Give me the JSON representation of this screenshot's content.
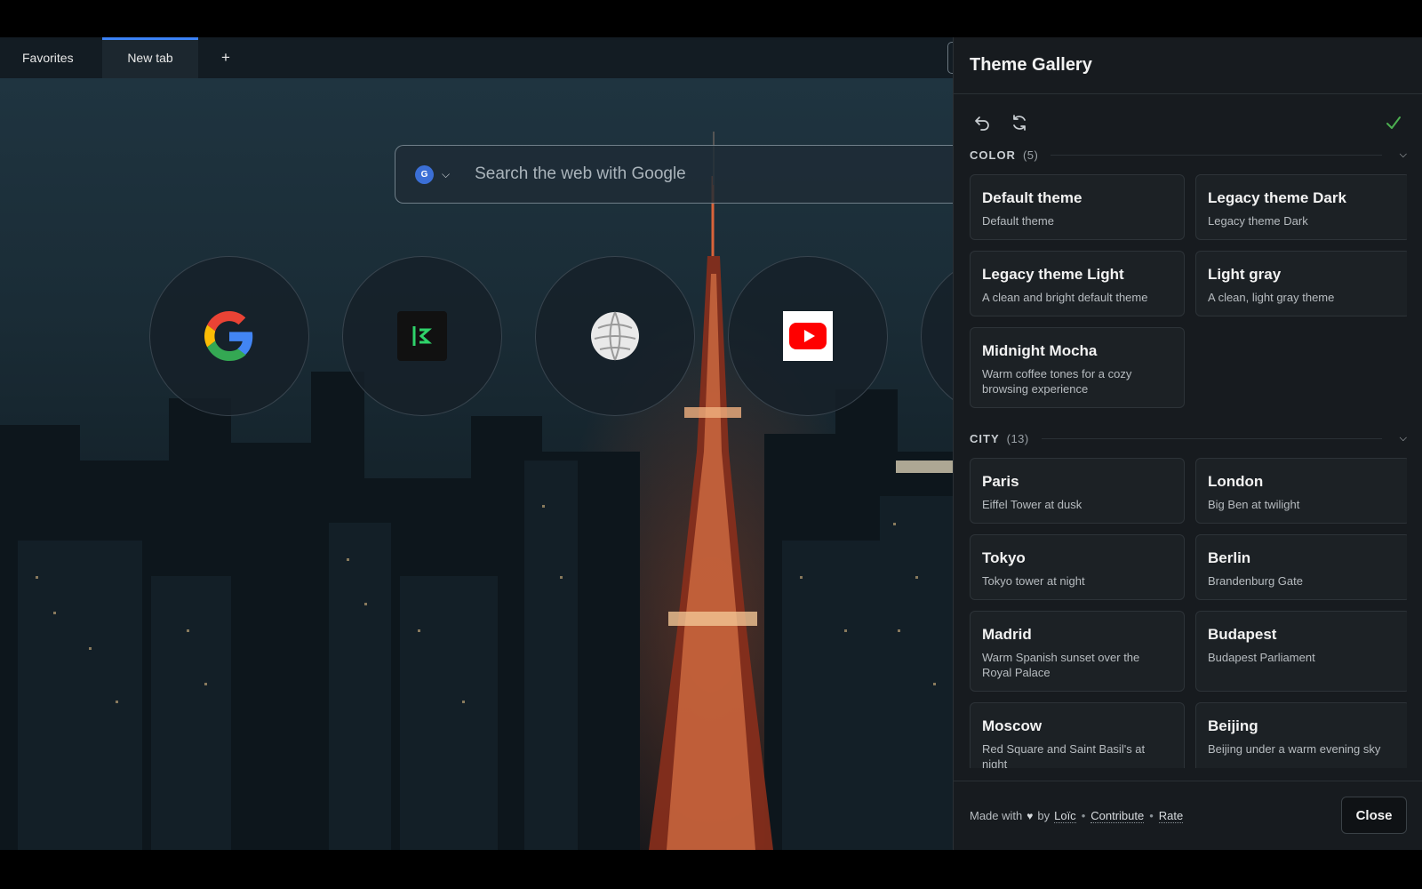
{
  "tabs": [
    {
      "label": "Favorites",
      "active": false
    },
    {
      "label": "New tab",
      "active": true
    }
  ],
  "tab_add": "+",
  "search": {
    "engine_letter": "G",
    "placeholder": "Search the web with Google"
  },
  "shortcuts": [
    {
      "name": "google-shortcut",
      "icon": "google-icon"
    },
    {
      "name": "pinboard-shortcut",
      "icon": "app-icon"
    },
    {
      "name": "wikipedia-shortcut",
      "icon": "wikipedia-icon"
    },
    {
      "name": "youtube-shortcut",
      "icon": "youtube-icon"
    },
    {
      "name": "partial-shortcut",
      "icon": "unknown-icon"
    }
  ],
  "panel": {
    "title": "Theme Gallery",
    "sections": [
      {
        "label": "COLOR",
        "count": "(5)",
        "themes": [
          {
            "title": "Default theme",
            "desc": "Default theme"
          },
          {
            "title": "Legacy theme Dark",
            "desc": "Legacy theme Dark"
          },
          {
            "title": "Legacy theme Light",
            "desc": "A clean and bright default theme"
          },
          {
            "title": "Light gray",
            "desc": "A clean, light gray theme"
          },
          {
            "title": "Midnight Mocha",
            "desc": "Warm coffee tones for a cozy browsing experience"
          }
        ]
      },
      {
        "label": "CITY",
        "count": "(13)",
        "themes": [
          {
            "title": "Paris",
            "desc": "Eiffel Tower at dusk"
          },
          {
            "title": "London",
            "desc": "Big Ben at twilight"
          },
          {
            "title": "Tokyo",
            "desc": "Tokyo tower at night"
          },
          {
            "title": "Berlin",
            "desc": "Brandenburg Gate"
          },
          {
            "title": "Madrid",
            "desc": "Warm Spanish sunset over the Royal Palace"
          },
          {
            "title": "Budapest",
            "desc": "Budapest Parliament"
          },
          {
            "title": "Moscow",
            "desc": "Red Square and Saint Basil's at night"
          },
          {
            "title": "Beijing",
            "desc": "Beijing under a warm evening sky"
          }
        ]
      }
    ],
    "footer": {
      "made_with": "Made with",
      "by": "by",
      "author": "Loïc",
      "contribute": "Contribute",
      "rate": "Rate",
      "separator": "•"
    },
    "close_label": "Close"
  },
  "colors": {
    "accent": "#3b82f6",
    "check": "#4caf50",
    "panel_bg": "#171b1f",
    "card_bg": "#1c2125"
  }
}
